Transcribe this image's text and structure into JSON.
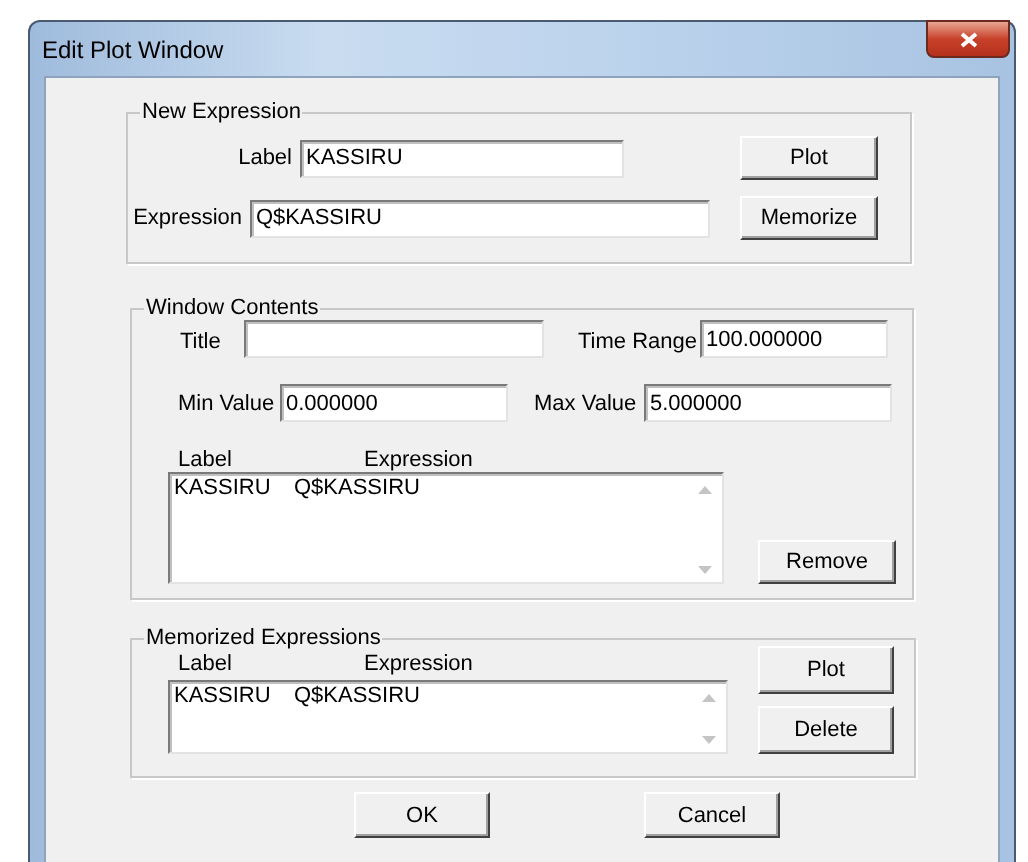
{
  "window": {
    "title": "Edit Plot Window"
  },
  "new_expression": {
    "title": "New Expression",
    "fields": [
      {
        "label": "Label",
        "value": "KASSIRU"
      },
      {
        "label": "Expression",
        "value": "Q$KASSIRU"
      }
    ],
    "buttons": [
      "Plot",
      "Memorize"
    ]
  },
  "window_contents": {
    "title": "Window Contents",
    "fields": [
      {
        "label": "Title"
      },
      {
        "label": "Time Range",
        "value": "100.000000"
      },
      {
        "label": "Min Value",
        "value": "0.000000"
      },
      {
        "label": "Max Value",
        "value": "5.000000"
      }
    ],
    "list": {
      "columns": [
        "Label",
        "Expression"
      ],
      "rows": [
        [
          "KASSIRU",
          "Q$KASSIRU"
        ]
      ]
    },
    "buttons": [
      "Remove"
    ]
  },
  "memorized_expressions": {
    "title": "Memorized Expressions",
    "list": {
      "columns": [
        "Label",
        "Expression"
      ],
      "rows": [
        [
          "KASSIRU",
          "Q$KASSIRU"
        ]
      ]
    },
    "buttons": [
      "Plot",
      "Delete"
    ]
  },
  "buttons": [
    "OK",
    "Cancel"
  ]
}
